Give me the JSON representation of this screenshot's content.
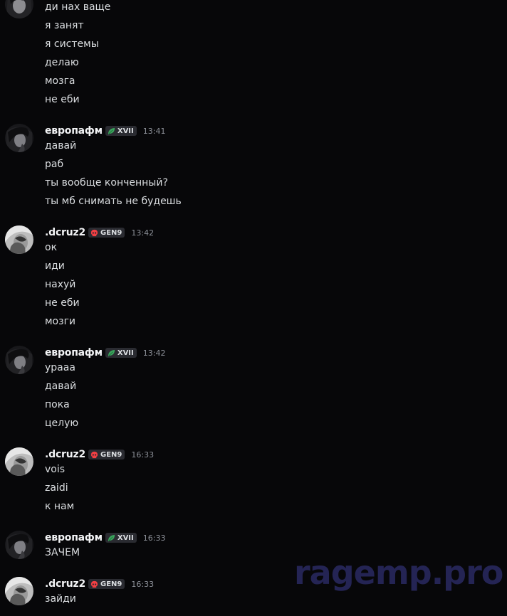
{
  "watermark": "ragemp.pro",
  "groups": [
    {
      "continuation": true,
      "lines": [
        "ди нах ваще",
        "я занят",
        "я системы",
        "делаю",
        "мозга",
        "не еби"
      ]
    },
    {
      "username": "европафм",
      "tag": "XVII",
      "tag_icon": "leaf-icon",
      "tag_color": "#3ba55d",
      "time": "13:41",
      "lines": [
        "давай",
        "раб",
        "ты вообще конченный?",
        "ты мб снимать не будешь"
      ]
    },
    {
      "username": ".dcruz2",
      "tag": "GEN9",
      "tag_icon": "skull-icon",
      "tag_color": "#f23f43",
      "time": "13:42",
      "lines": [
        "ок",
        "иди",
        "нахуй",
        "не еби",
        "мозги"
      ]
    },
    {
      "username": "европафм",
      "tag": "XVII",
      "tag_icon": "leaf-icon",
      "tag_color": "#3ba55d",
      "time": "13:42",
      "lines": [
        "урааа",
        "давай",
        "пока",
        "целую"
      ]
    },
    {
      "username": ".dcruz2",
      "tag": "GEN9",
      "tag_icon": "skull-icon",
      "tag_color": "#f23f43",
      "time": "16:33",
      "lines": [
        "vois",
        "zaidi",
        "к нам"
      ]
    },
    {
      "username": "европафм",
      "tag": "XVII",
      "tag_icon": "leaf-icon",
      "tag_color": "#3ba55d",
      "time": "16:33",
      "lines": [
        "ЗАЧЕМ"
      ]
    },
    {
      "username": ".dcruz2",
      "tag": "GEN9",
      "tag_icon": "skull-icon",
      "tag_color": "#f23f43",
      "time": "16:33",
      "lines": [
        "зайди"
      ]
    }
  ]
}
